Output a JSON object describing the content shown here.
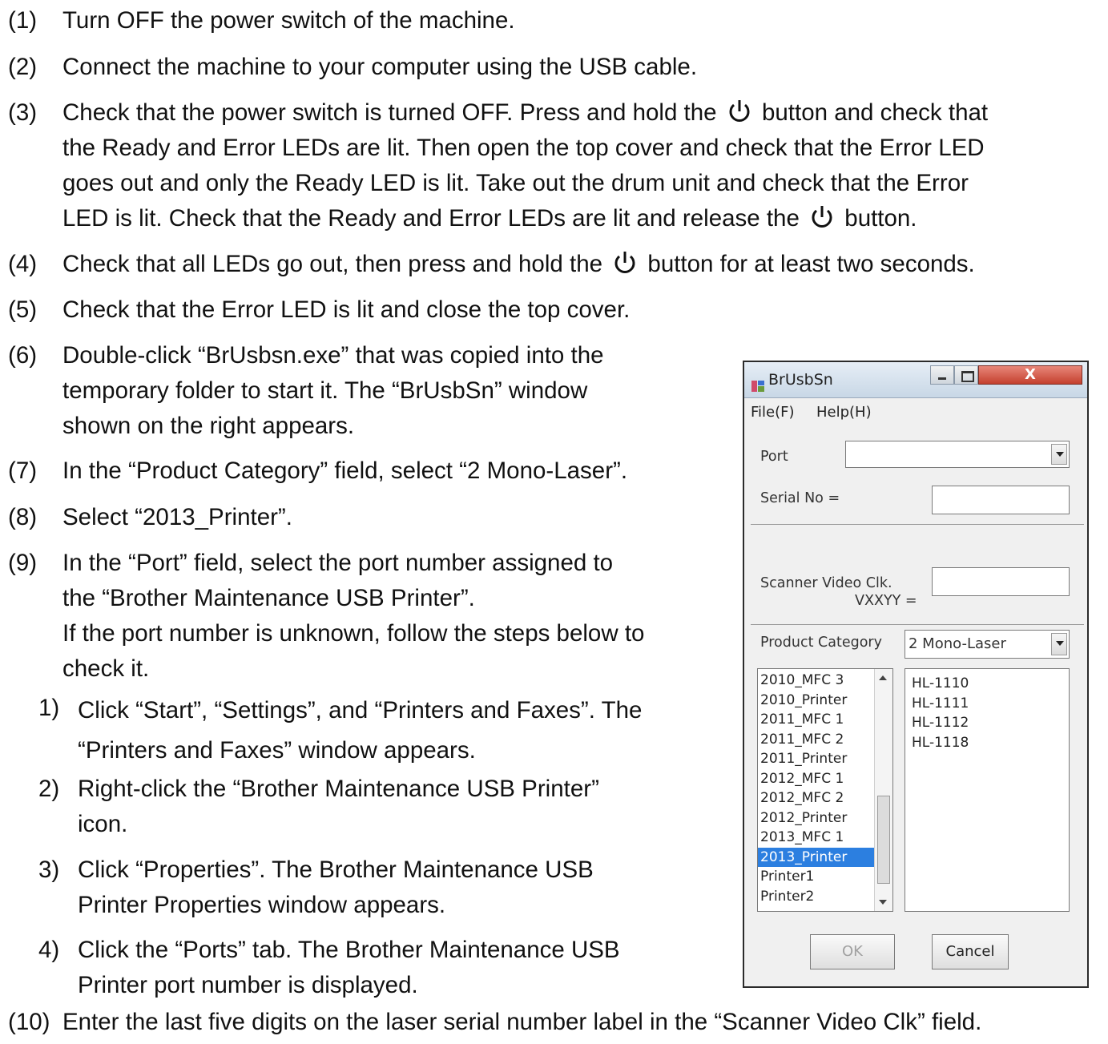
{
  "steps": [
    {
      "num": "(1)",
      "lines": [
        "Turn OFF the power switch of the machine."
      ]
    },
    {
      "num": "(2)",
      "lines": [
        "Connect the machine to your computer using the USB cable."
      ]
    },
    {
      "num": "(3)",
      "lines": [
        "Check that the power switch is turned OFF. Press and hold the",
        "button and check that",
        "the Ready and Error LEDs are lit. Then open the top cover and check that the Error LED",
        "goes out and only the Ready LED is lit. Take out the drum unit and check that the Error",
        "LED is lit. Check that the Ready and Error LEDs are lit and release the",
        "button."
      ]
    },
    {
      "num": "(4)",
      "lines": [
        "Check that all LEDs go out, then press and hold the",
        "button for at least two seconds."
      ]
    },
    {
      "num": "(5)",
      "lines": [
        "Check that the Error LED is lit and close the top cover."
      ]
    },
    {
      "num": "(6)",
      "lines": [
        "Double-click “BrUsbsn.exe” that was copied into the",
        "temporary folder to start it. The “BrUsbSn” window",
        "shown on the right appears."
      ]
    },
    {
      "num": "(7)",
      "lines": [
        "In the “Product Category” field, select “2 Mono-Laser”."
      ]
    },
    {
      "num": "(8)",
      "lines": [
        "Select “2013_Printer”."
      ]
    },
    {
      "num": "(9)",
      "lines": [
        "In the “Port” field, select the port number assigned to",
        "the “Brother Maintenance USB Printer”.",
        "If the port number is unknown, follow the steps below to",
        "check it."
      ]
    },
    {
      "num": "(10)",
      "lines": [
        "Enter the last five digits on the laser serial number label in the “Scanner Video Clk” field."
      ]
    }
  ],
  "substeps": [
    {
      "num": "1)",
      "lines": [
        "Click “Start”, “Settings”, and “Printers and Faxes”. The",
        "“Printers and Faxes” window appears."
      ]
    },
    {
      "num": "2)",
      "lines": [
        "Right-click the “Brother Maintenance USB Printer”",
        "icon."
      ]
    },
    {
      "num": "3)",
      "lines": [
        "Click “Properties”. The Brother Maintenance USB",
        "Printer Properties window appears."
      ]
    },
    {
      "num": "4)",
      "lines": [
        "Click the “Ports” tab. The Brother Maintenance USB",
        "Printer port number is displayed."
      ]
    }
  ],
  "icons": {
    "power": "power-button-icon",
    "app": "brusbsn-app-icon"
  },
  "dialog": {
    "title": "BrUsbSn",
    "close_glyph": "X",
    "menu": [
      "File(F)",
      "Help(H)"
    ],
    "port_label": "Port",
    "port_value": "",
    "serial_label": "Serial No =",
    "serial_value": "",
    "scanner_label_1": "Scanner Video Clk.",
    "scanner_label_2": "VXXYY =",
    "scanner_value": "",
    "category_label": "Product Category",
    "category_value": "2 Mono-Laser",
    "categories": [
      "2010_MFC 3",
      "2010_Printer",
      "2011_MFC 1",
      "2011_MFC 2",
      "2011_Printer",
      "2012_MFC 1",
      "2012_MFC 2",
      "2012_Printer",
      "2013_MFC 1",
      "2013_Printer",
      "Printer1",
      "Printer2"
    ],
    "selected_category": "2013_Printer",
    "models": [
      "HL-1110",
      "HL-1111",
      "HL-1112",
      "HL-1118"
    ],
    "ok_label": "OK",
    "cancel_label": "Cancel",
    "selection_color": "#2c7fe0"
  }
}
